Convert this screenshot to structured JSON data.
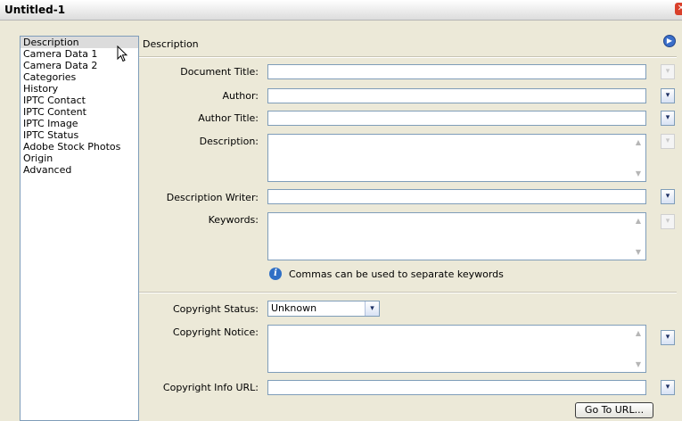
{
  "window": {
    "title": "Untitled-1"
  },
  "sidebar": {
    "items": [
      {
        "label": "Description"
      },
      {
        "label": "Camera Data 1"
      },
      {
        "label": "Camera Data 2"
      },
      {
        "label": "Categories"
      },
      {
        "label": "History"
      },
      {
        "label": "IPTC Contact"
      },
      {
        "label": "IPTC Content"
      },
      {
        "label": "IPTC Image"
      },
      {
        "label": "IPTC Status"
      },
      {
        "label": "Adobe Stock Photos"
      },
      {
        "label": "Origin"
      },
      {
        "label": "Advanced"
      }
    ],
    "selected": "Description"
  },
  "panel": {
    "title": "Description",
    "labels": {
      "document_title": "Document Title:",
      "author": "Author:",
      "author_title": "Author Title:",
      "description": "Description:",
      "description_writer": "Description Writer:",
      "keywords": "Keywords:",
      "copyright_status": "Copyright Status:",
      "copyright_notice": "Copyright Notice:",
      "copyright_info_url": "Copyright Info URL:"
    },
    "values": {
      "document_title": "",
      "author": "",
      "author_title": "",
      "description": "",
      "description_writer": "",
      "keywords": "",
      "copyright_notice": "",
      "copyright_info_url": ""
    },
    "keywords_hint": "Commas can be used to separate keywords",
    "copyright_status_value": "Unknown",
    "go_to_url_label": "Go To URL..."
  },
  "icons": {
    "close": "close-icon",
    "menu": "panel-menu-icon",
    "info": "info-icon",
    "dropdown": "chevron-down-icon"
  }
}
